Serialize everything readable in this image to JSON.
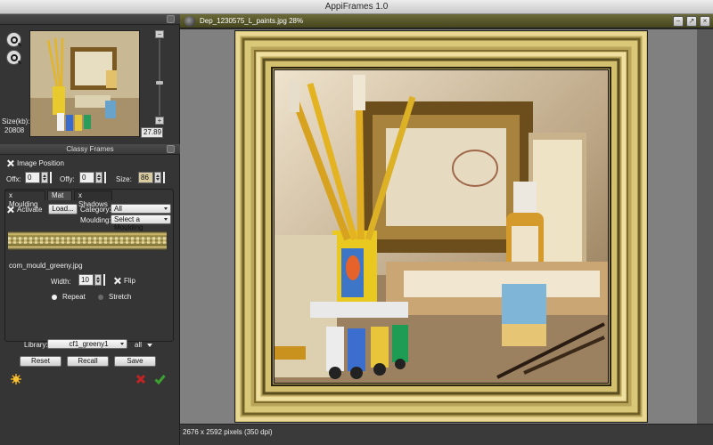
{
  "window": {
    "title": "AppiFrames 1.0"
  },
  "navigator": {
    "size_label": "Size(kb):",
    "size_value": "20808",
    "zoom_value": "27.89",
    "zoom_level_fraction": 0.43
  },
  "classy_frames": {
    "header": "Classy Frames",
    "image_position_label": "Image Position",
    "offx_label": "Offx:",
    "offx_value": "0",
    "offy_label": "Offy:",
    "offy_value": "0",
    "size_label": "Size:",
    "size_value": "86",
    "tabs": [
      {
        "label": "x Moulding"
      },
      {
        "label": "Mat"
      },
      {
        "label": "x Shadows"
      }
    ],
    "activate_label": "Activate",
    "load_button": "Load...",
    "category_label": "Category:",
    "category_value": "All",
    "moulding_label": "Moulding:",
    "moulding_value": "Select a Moulding",
    "moulding_file": "com_mould_greeny.jpg",
    "width_label": "Width:",
    "width_value": "10",
    "flip_label": "Flip",
    "repeat_label": "Repeat",
    "stretch_label": "Stretch"
  },
  "library": {
    "label": "Library:",
    "value": "cf1_greeny1",
    "filter_value": "all"
  },
  "actions": {
    "reset": "Reset",
    "recall": "Recall",
    "save": "Save"
  },
  "document": {
    "title": "Dep_1230575_L_paints.jpg 28%",
    "status": "2676 x 2592 pixels (350 dpi)",
    "win_minimize": "–",
    "win_restore": "↗",
    "win_close": "×"
  },
  "colors": {
    "panel_bg": "#353535",
    "canvas_bg": "#808080",
    "frame_gold": "#c9b465",
    "doc_tab": "#5a5a2c",
    "radio_selected": "#f0f0f0",
    "radio_unselected": "#6a6a6a",
    "cancel_red": "#c22323",
    "ok_green": "#3aa12f"
  },
  "icons": {
    "zoom_in": "zoom-in-icon",
    "zoom_out": "zoom-out-icon",
    "settings": "sun-gear-icon",
    "cancel": "cancel-icon",
    "apply": "checkmark-icon"
  }
}
